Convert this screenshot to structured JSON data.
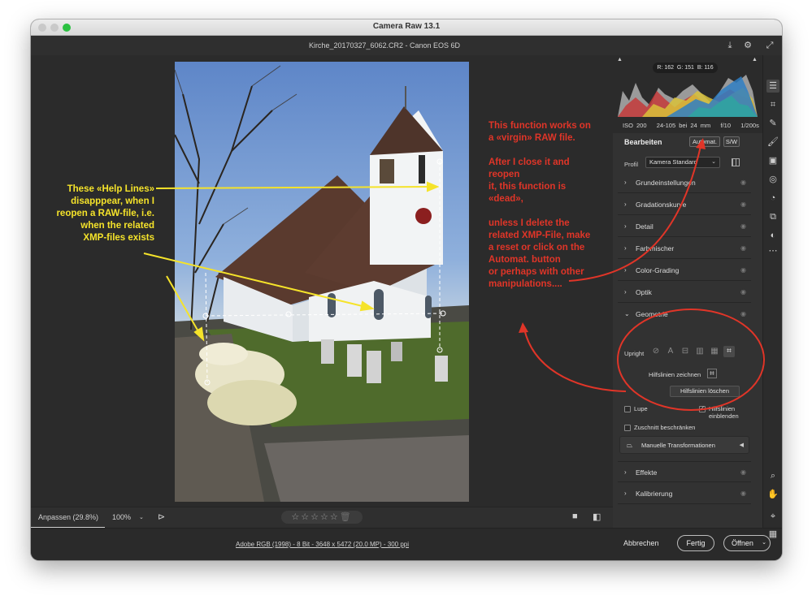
{
  "window": {
    "title": "Camera Raw 13.1",
    "file_title": "Kirche_20170327_6062.CR2  -  Canon EOS 6D"
  },
  "histogram": {
    "r_label": "R:",
    "r_value": "162",
    "g_label": "G:",
    "g_value": "151",
    "b_label": "B:",
    "b_value": "116"
  },
  "exif": {
    "iso": "ISO 200",
    "lens": "24-105 bei 24 mm",
    "aperture": "f/10",
    "shutter": "1/200s"
  },
  "edit_panel": {
    "title": "Bearbeiten",
    "auto_button": "Automat.",
    "bw_button": "S/W",
    "profile_label": "Profil",
    "profile_value": "Kamera Standard",
    "sections_top": [
      "Grundeinstellungen",
      "Gradationskurve",
      "Detail",
      "Farbmischer",
      "Color-Grading",
      "Optik"
    ],
    "geometry": {
      "title": "Geometrie",
      "upright_label": "Upright",
      "guides_label": "Hilfslinien zeichnen",
      "clear_guides_button": "Hilfslinien löschen",
      "loupe_label": "Lupe",
      "show_guides_label": "Hilfslinien einblenden",
      "constrain_crop_label": "Zuschnitt beschränken",
      "manual_transform_label": "Manuelle Transformationen"
    },
    "sections_bottom": [
      "Effekte",
      "Kalibrierung"
    ]
  },
  "bottom_toolbar": {
    "fit_label": "Anpassen (29.8%)",
    "zoom_label": "100%"
  },
  "footer": {
    "file_info": "Adobe RGB (1998) - 8 Bit - 3648 x 5472 (20.0 MP) - 300 ppi",
    "cancel": "Abbrechen",
    "done": "Fertig",
    "open": "Öffnen"
  },
  "annotations": {
    "yellow_lines": [
      "These «Help Lines»",
      "disapppear, when I",
      "reopen a RAW-file, i.e.",
      "when the related",
      "XMP-files exists"
    ],
    "red_lines": [
      "This function works on",
      "a «virgin» RAW file.",
      "",
      "After I close it and",
      "reopen",
      "it, this function is",
      "«dead»,",
      "",
      "unless I delete the",
      "related XMP-File, make",
      "a reset or click on the",
      "Automat. button",
      "or perhaps with other",
      "manipulations...."
    ]
  },
  "colors": {
    "annotation_yellow": "#f5e32a",
    "annotation_red": "#e03528",
    "ui_dark": "#323232"
  }
}
